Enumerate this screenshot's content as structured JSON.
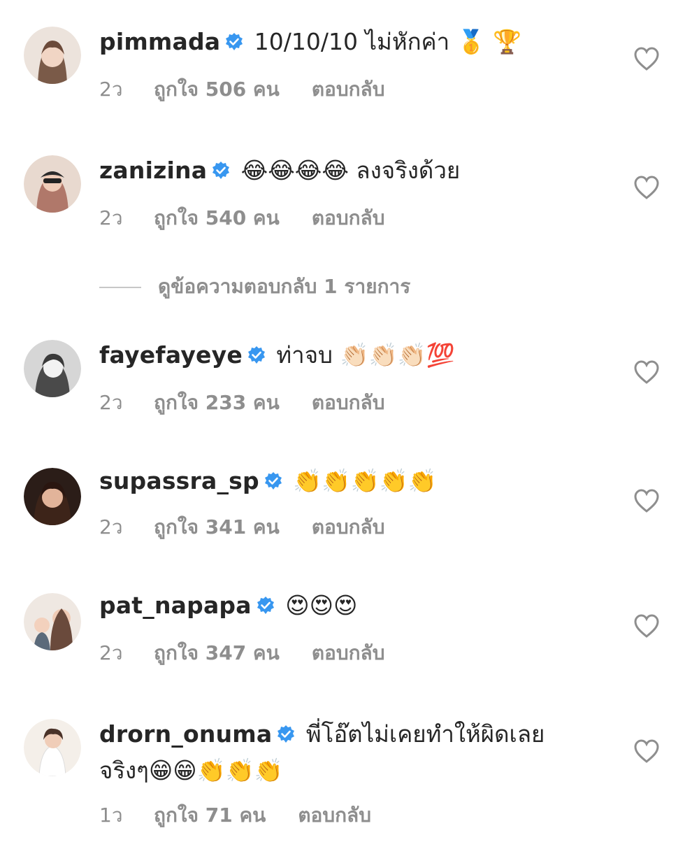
{
  "comments": [
    {
      "username": "pimmada",
      "text": "10/10/10 ไม่หักค่า 🥇 🏆",
      "time": "2ว",
      "likes": "ถูกใจ 506 คน",
      "reply": "ตอบกลับ",
      "avatar_color": "#d9c2b4"
    },
    {
      "username": "zanizina",
      "text": "😂😂😂😂 ลงจริงด้วย",
      "time": "2ว",
      "likes": "ถูกใจ 540 คน",
      "reply": "ตอบกลับ",
      "avatar_color": "#c9a896"
    },
    {
      "username": "fayefayeye",
      "text": "ท่าจบ 👏🏻👏🏻👏🏻💯",
      "time": "2ว",
      "likes": "ถูกใจ 233 คน",
      "reply": "ตอบกลับ",
      "avatar_color": "#a9a9a9"
    },
    {
      "username": "supassra_sp",
      "text": "👏👏👏👏👏",
      "time": "2ว",
      "likes": "ถูกใจ 341 คน",
      "reply": "ตอบกลับ",
      "avatar_color": "#5a3a2c"
    },
    {
      "username": "pat_napapa",
      "text": "😍😍😍",
      "time": "2ว",
      "likes": "ถูกใจ 347 คน",
      "reply": "ตอบกลับ",
      "avatar_color": "#b8a394"
    },
    {
      "username": "drorn_onuma",
      "text": "พี่โอ๊ตไม่เคยทำให้ผิดเลย จริงๆ😁😁👏👏👏",
      "time": "1ว",
      "likes": "ถูกใจ 71 คน",
      "reply": "ตอบกลับ",
      "avatar_color": "#e2d6cd"
    }
  ],
  "view_replies": "ดูข้อความตอบกลับ 1 รายการ",
  "colors": {
    "verified": "#3897f0",
    "secondary_text": "#8e8e8e",
    "primary_text": "#262626"
  },
  "icons": {
    "verified": "verified-badge-icon",
    "like": "heart-outline-icon"
  }
}
